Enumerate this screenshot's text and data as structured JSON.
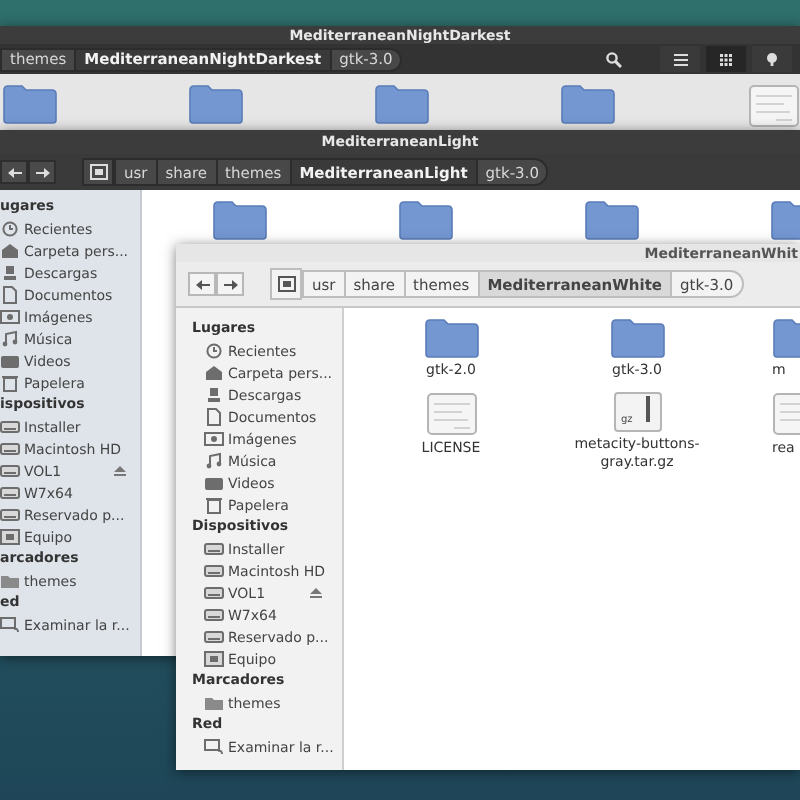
{
  "windows": [
    {
      "title": "MediterraneanNightDarkest",
      "kind": "dark",
      "show_navigation": false,
      "root_button": false,
      "path": [
        {
          "label": "themes",
          "selected": false
        },
        {
          "label": "MediterraneanNightDarkest",
          "selected": true
        },
        {
          "label": "gtk-3.0",
          "selected": false
        }
      ],
      "search_button": true,
      "view_buttons": [
        {
          "kind": "list",
          "selected": false
        },
        {
          "kind": "grid",
          "selected": true
        },
        {
          "kind": "menu",
          "selected": false
        }
      ],
      "files": [
        {
          "kind": "folder"
        },
        {
          "kind": "folder"
        },
        {
          "kind": "folder"
        },
        {
          "kind": "folder"
        },
        {
          "kind": "text"
        }
      ]
    },
    {
      "title": "MediterraneanLight",
      "kind": "light",
      "show_navigation": true,
      "root_button": true,
      "path": [
        {
          "label": "usr",
          "selected": false
        },
        {
          "label": "share",
          "selected": false
        },
        {
          "label": "themes",
          "selected": false
        },
        {
          "label": "MediterraneanLight",
          "selected": true
        },
        {
          "label": "gtk-3.0",
          "selected": false
        }
      ],
      "search_button": false,
      "sidebar": [
        {
          "heading": "ugares",
          "items": [
            {
              "label": "Recientes",
              "kind": "recent"
            },
            {
              "label": "Carpeta pers...",
              "kind": "home"
            },
            {
              "label": "Descargas",
              "kind": "download"
            },
            {
              "label": "Documentos",
              "kind": "document"
            },
            {
              "label": "Imágenes",
              "kind": "image"
            },
            {
              "label": "Música",
              "kind": "music"
            },
            {
              "label": "Videos",
              "kind": "video"
            },
            {
              "label": "Papelera",
              "kind": "trash"
            }
          ]
        },
        {
          "heading": "ispositivos",
          "items": [
            {
              "label": "Installer",
              "kind": "drive"
            },
            {
              "label": "Macintosh HD",
              "kind": "drive"
            },
            {
              "label": "VOL1",
              "kind": "drive",
              "eject": true
            },
            {
              "label": "W7x64",
              "kind": "drive"
            },
            {
              "label": "Reservado p...",
              "kind": "drive"
            },
            {
              "label": "Equipo",
              "kind": "computer"
            }
          ]
        },
        {
          "heading": "arcadores",
          "items": [
            {
              "label": "themes",
              "kind": "folder"
            }
          ]
        },
        {
          "heading": "ed",
          "items": [
            {
              "label": "Examinar la r...",
              "kind": "network"
            }
          ]
        }
      ],
      "files": [
        {
          "kind": "folder"
        },
        {
          "kind": "folder"
        },
        {
          "kind": "folder"
        },
        {
          "kind": "folder"
        }
      ]
    },
    {
      "title": "MediterraneanWhit",
      "kind": "white",
      "show_navigation": true,
      "root_button": true,
      "path": [
        {
          "label": "usr",
          "selected": false
        },
        {
          "label": "share",
          "selected": false
        },
        {
          "label": "themes",
          "selected": false
        },
        {
          "label": "MediterraneanWhite",
          "selected": true
        },
        {
          "label": "gtk-3.0",
          "selected": false
        }
      ],
      "search_button": false,
      "sidebar": [
        {
          "heading": "Lugares",
          "items": [
            {
              "label": "Recientes",
              "kind": "recent"
            },
            {
              "label": "Carpeta pers...",
              "kind": "home"
            },
            {
              "label": "Descargas",
              "kind": "download"
            },
            {
              "label": "Documentos",
              "kind": "document"
            },
            {
              "label": "Imágenes",
              "kind": "image"
            },
            {
              "label": "Música",
              "kind": "music"
            },
            {
              "label": "Videos",
              "kind": "video"
            },
            {
              "label": "Papelera",
              "kind": "trash"
            }
          ]
        },
        {
          "heading": "Dispositivos",
          "items": [
            {
              "label": "Installer",
              "kind": "drive"
            },
            {
              "label": "Macintosh HD",
              "kind": "drive"
            },
            {
              "label": "VOL1",
              "kind": "drive",
              "eject": true
            },
            {
              "label": "W7x64",
              "kind": "drive"
            },
            {
              "label": "Reservado p...",
              "kind": "drive"
            },
            {
              "label": "Equipo",
              "kind": "computer"
            }
          ]
        },
        {
          "heading": "Marcadores",
          "items": [
            {
              "label": "themes",
              "kind": "folder"
            }
          ]
        },
        {
          "heading": "Red",
          "items": [
            {
              "label": "Examinar la r...",
              "kind": "network"
            }
          ]
        }
      ],
      "files": [
        {
          "kind": "folder",
          "name": "gtk-2.0"
        },
        {
          "kind": "folder",
          "name": "gtk-3.0"
        },
        {
          "kind": "folder",
          "name": "m"
        },
        {
          "kind": "text",
          "name": "LICENSE"
        },
        {
          "kind": "archive",
          "name": "metacity-buttons-gray.tar.gz",
          "badge": "gz"
        },
        {
          "kind": "text",
          "name": "rea"
        }
      ]
    }
  ]
}
